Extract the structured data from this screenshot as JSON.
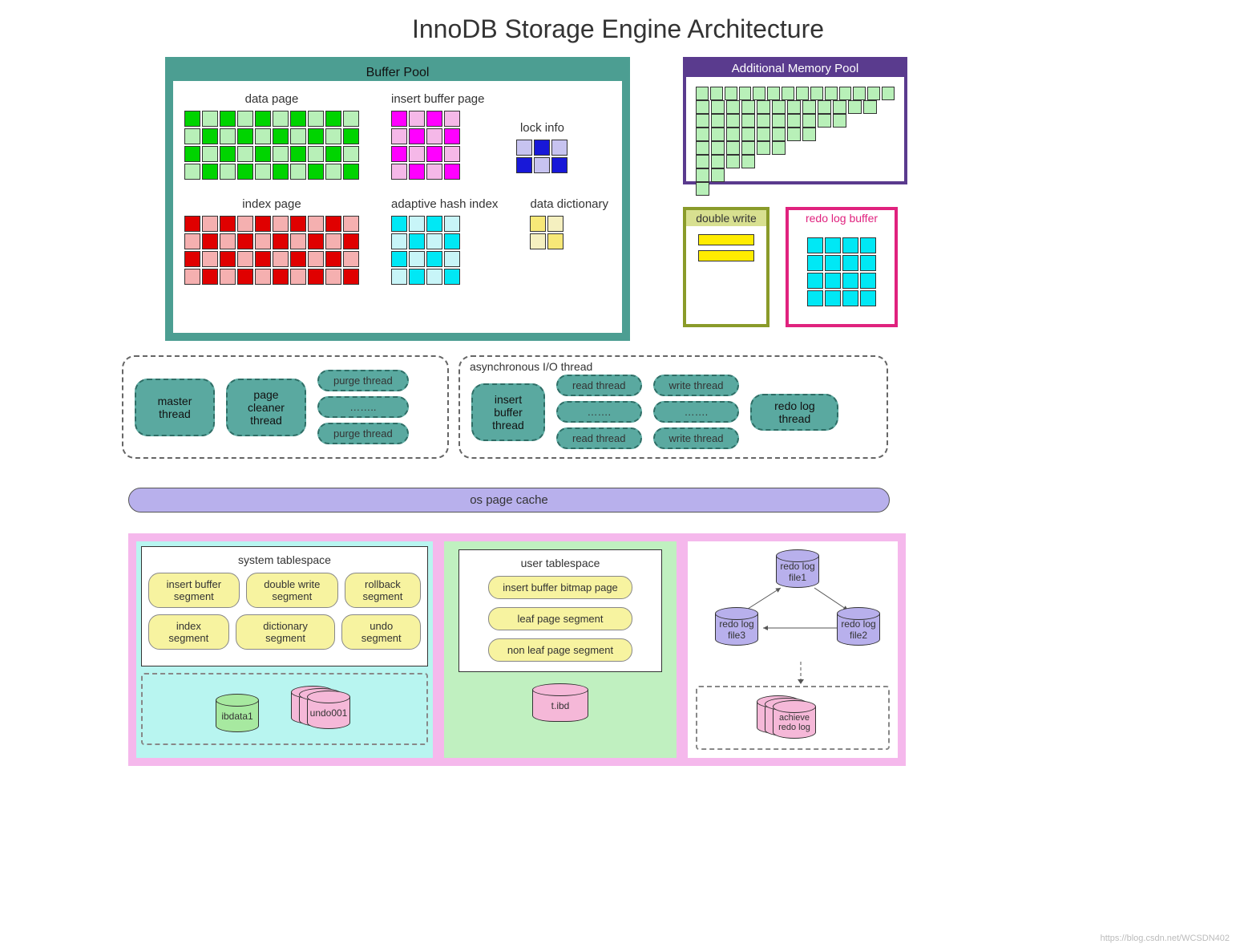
{
  "title": "InnoDB Storage Engine Architecture",
  "buffer_pool": {
    "title": "Buffer Pool",
    "data_page": {
      "label": "data page",
      "cols": 10,
      "rows": 4,
      "pattern": "checker",
      "colors": [
        "#00d400",
        "#b8f0b8"
      ]
    },
    "insert_buffer_page": {
      "label": "insert buffer page",
      "cols": 4,
      "rows": 4,
      "pattern": "checker",
      "colors": [
        "#ff00ff",
        "#f5b8e8"
      ]
    },
    "lock_info": {
      "label": "lock info",
      "cols": 3,
      "rows": 2,
      "explicit": [
        "#c7c3f0",
        "#1818d8",
        "#c7c3f0",
        "#1818d8",
        "#c7c3f0",
        "#1818d8"
      ]
    },
    "index_page": {
      "label": "index page",
      "cols": 10,
      "rows": 4,
      "pattern": "checker",
      "colors": [
        "#e00000",
        "#f5b0b0"
      ]
    },
    "adaptive_hash_index": {
      "label": "adaptive hash index",
      "cols": 4,
      "rows": 4,
      "pattern": "checker",
      "colors": [
        "#00e8f5",
        "#c8f5f8"
      ]
    },
    "data_dictionary": {
      "label": "data dictionary",
      "cols": 2,
      "rows": 2,
      "explicit": [
        "#f7e878",
        "#f5f0c0",
        "#f5f0c0",
        "#f7e878"
      ]
    }
  },
  "additional_memory_pool": {
    "title": "Additional Memory Pool",
    "staircase_counts": [
      1,
      2,
      4,
      6,
      8,
      10,
      12,
      14
    ],
    "color": "#b8f0b8"
  },
  "double_write": {
    "title": "double write",
    "bars": 2
  },
  "redo_log_buffer": {
    "title": "redo log buffer",
    "cols": 4,
    "rows": 4,
    "color": "#00e8f5"
  },
  "threads": {
    "left": {
      "master": "master thread",
      "page_cleaner": "page cleaner thread",
      "purge": {
        "top": "purge thread",
        "mid": "……..",
        "bot": "purge thread"
      }
    },
    "async": {
      "label": "asynchronous I/O thread",
      "insert_buffer": "insert buffer thread",
      "read": {
        "top": "read thread",
        "mid": "…….",
        "bot": "read thread"
      },
      "write": {
        "top": "write thread",
        "mid": "…….",
        "bot": "write thread"
      },
      "redo": "redo log thread"
    }
  },
  "os_cache": "os page cache",
  "storage": {
    "system_tablespace": {
      "title": "system tablespace",
      "row1": [
        "insert buffer segment",
        "double write segment",
        "rollback segment"
      ],
      "row2": [
        "index segment",
        "dictionary segment",
        "undo segment"
      ],
      "ibdata": "ibdata1",
      "undo": "undo001"
    },
    "user_tablespace": {
      "title": "user tablespace",
      "items": [
        "insert buffer bitmap page",
        "leaf page segment",
        "non leaf page segment"
      ],
      "file": "t.ibd"
    },
    "redo_files": {
      "file1": "redo log file1",
      "file2": "redo log file2",
      "file3": "redo log file3",
      "archive": "achieve redo log"
    }
  },
  "watermark": "https://blog.csdn.net/WCSDN402"
}
